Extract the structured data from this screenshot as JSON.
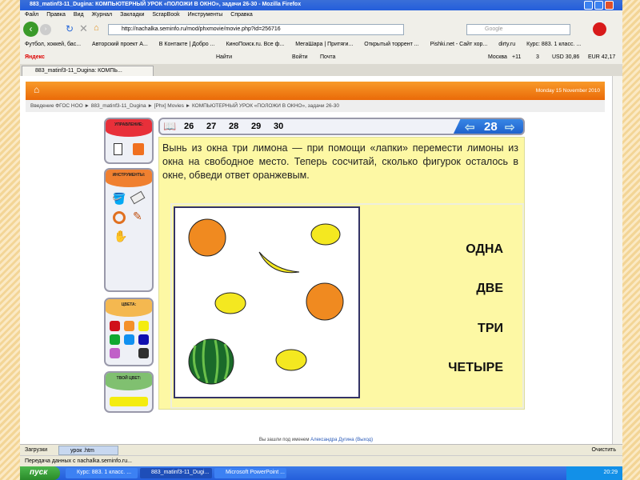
{
  "window": {
    "title": "883_matinf3-11_Dugina: КОМПЬЮТЕРНЫЙ УРОК «ПОЛОЖИ В ОКНО», задачи 26-30 - Mozilla Firefox"
  },
  "menu": [
    "Файл",
    "Правка",
    "Вид",
    "Журнал",
    "Закладки",
    "ScrapBook",
    "Инструменты",
    "Справка"
  ],
  "nav": {
    "url": "http://nachalka.seminfo.ru/mod/phxmovie/movie.php?id=256716",
    "search_placeholder": "Google"
  },
  "bookmarks": [
    "Футбол, хоккей, бас...",
    "Авторский проект А...",
    "В Контакте | Добро ...",
    "КиноПоиск.ru. Все ф...",
    "МегаШара | Притяги...",
    "Открытый торрент ...",
    "Pishki.net - Сайт хор...",
    "dirty.ru",
    "Курс: 883. 1 класс. ..."
  ],
  "yandex": {
    "logo": "Яндекс",
    "find": "Найти",
    "login": "Войти",
    "mail": "Почта",
    "city": "Москва",
    "temp": "+11",
    "count": "3",
    "usd": "USD 30,86",
    "eur": "EUR 42,17"
  },
  "tab": {
    "label": "883_matinf3-11_Dugina: КОМПЬ..."
  },
  "page": {
    "date": "Monday 15 November 2010",
    "breadcrumb": "Введение ФГОС НОО ► 883_matinf3-11_Dugina ► [Phx] Movies ► КОМПЬЮТЕРНЫЙ УРОК «ПОЛОЖИ В ОКНО», задачи 26-30",
    "login_prefix": "Вы зашли под именем",
    "user": "Александра Дугина",
    "logout": "(Выход)"
  },
  "lesson": {
    "panel_control": "УПРАВЛЕНИЕ:",
    "panel_tools": "ИНСТРУМЕНТЫ:",
    "panel_colors": "ЦВЕТА:",
    "panel_mycolor": "ТВОЙ ЦВЕТ:",
    "colors": [
      "#d0101a",
      "#f4902a",
      "#f4ec10",
      "#10a830",
      "#1090f0",
      "#1010b0",
      "#c060c8",
      "#303030"
    ],
    "my_color": "#f4ec10",
    "tasks": [
      "26",
      "27",
      "28",
      "29",
      "30"
    ],
    "current": "28",
    "text": "Вынь из окна три лимона — при помощи «лапки» перемести лимоны из окна на свободное место. Теперь сосчитай, сколько фигурок осталось в окне, обведи ответ оранжевым.",
    "answers": [
      "ОДНА",
      "ДВЕ",
      "ТРИ",
      "ЧЕТЫРЕ"
    ]
  },
  "status": {
    "downloads": "Загрузки",
    "file": "урок .htm",
    "clear": "Очистить",
    "transfer": "Передача данных с nachalka.seminfo.ru..."
  },
  "taskbar": {
    "start": "пуск",
    "items": [
      "Курс: 883. 1 класс. ...",
      "883_matinf3-11_Dugi...",
      "Microsoft PowerPoint ..."
    ],
    "clock": "20:29"
  }
}
